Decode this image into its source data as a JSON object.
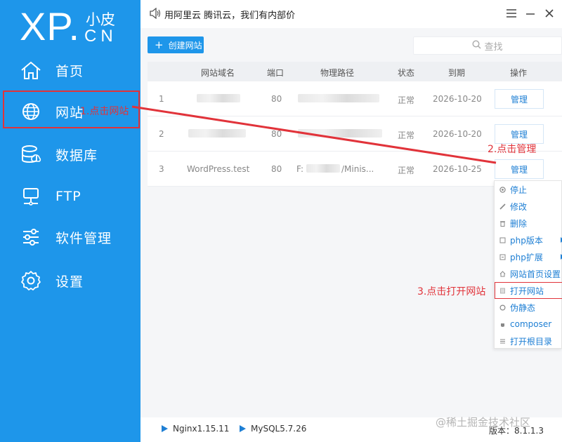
{
  "sidebar": {
    "logo_main": "XP",
    "logo_dot": ".",
    "logo_top": "小皮",
    "logo_bottom": "CN",
    "items": [
      {
        "label": "首页",
        "icon": "home-icon"
      },
      {
        "label": "网站",
        "icon": "globe-icon"
      },
      {
        "label": "数据库",
        "icon": "database-icon"
      },
      {
        "label": "FTP",
        "icon": "ftp-server-icon"
      },
      {
        "label": "软件管理",
        "icon": "sliders-icon"
      },
      {
        "label": "设置",
        "icon": "gear-icon"
      }
    ]
  },
  "topbar": {
    "notice": "用阿里云 腾讯云，我们有内部价"
  },
  "toolbar": {
    "create_label": "创建网站",
    "search_placeholder": "查找"
  },
  "table": {
    "headers": [
      "网站域名",
      "端口",
      "物理路径",
      "状态",
      "到期",
      "操作"
    ],
    "rows": [
      {
        "index": "1",
        "domain": "",
        "port": "80",
        "path": "",
        "status": "正常",
        "expiry": "2026-10-20",
        "action": "管理"
      },
      {
        "index": "2",
        "domain": "",
        "port": "80",
        "path": "",
        "status": "正常",
        "expiry": "2026-10-20",
        "action": "管理"
      },
      {
        "index": "3",
        "domain": "WordPress.test",
        "port": "80",
        "path_prefix": "F:",
        "path_suffix": "/Minis...",
        "status": "正常",
        "expiry": "2026-10-25",
        "action": "管理"
      }
    ]
  },
  "context_menu": {
    "items": [
      {
        "label": "停止",
        "icon": "stop-icon"
      },
      {
        "label": "修改",
        "icon": "pencil-icon"
      },
      {
        "label": "删除",
        "icon": "trash-icon"
      },
      {
        "label": "php版本",
        "icon": "php-icon",
        "submenu": true
      },
      {
        "label": "php扩展",
        "icon": "extension-icon",
        "submenu": true
      },
      {
        "label": "网站首页设置",
        "icon": "home-small-icon"
      },
      {
        "label": "打开网站",
        "icon": "open-site-icon"
      },
      {
        "label": "伪静态",
        "icon": "rewrite-icon"
      },
      {
        "label": "composer",
        "icon": "composer-icon"
      },
      {
        "label": "打开根目录",
        "icon": "folder-list-icon"
      }
    ]
  },
  "footer": {
    "services": [
      "Nginx1.15.11",
      "MySQL5.7.26"
    ],
    "version": "版本：8.1.1.3"
  },
  "watermark": "@稀土掘金技术社区",
  "annotations": {
    "step1": "1.点击网站",
    "step2": "2.点击管理",
    "step3": "3.点击打开网站",
    "color": "#e1333a"
  },
  "colors": {
    "sidebar": "#1e96ea",
    "accent": "#1e7fd4",
    "annotation": "#e1333a"
  }
}
